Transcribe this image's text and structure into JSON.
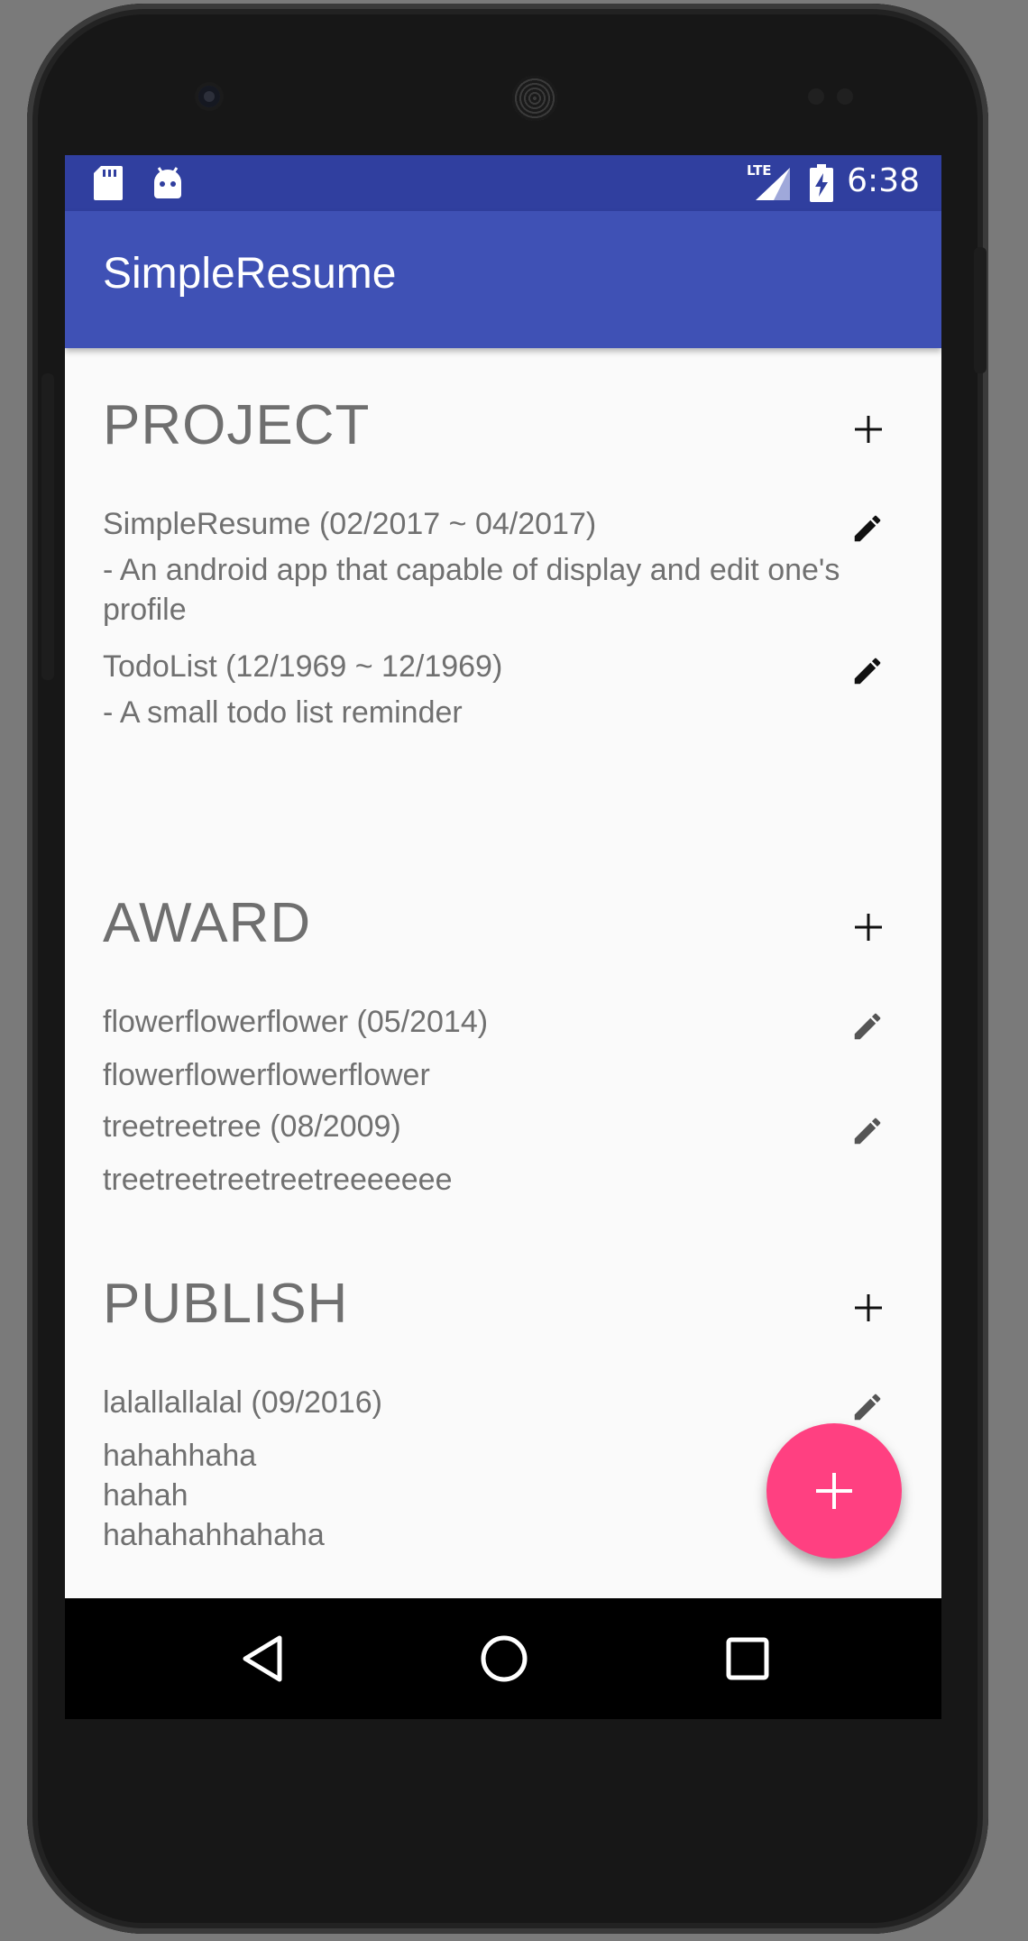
{
  "status_bar": {
    "time": "6:38",
    "network": "LTE",
    "icons": [
      "sd-card-icon",
      "android-icon",
      "signal-icon",
      "battery-charging-icon"
    ]
  },
  "app_bar": {
    "title": "SimpleResume"
  },
  "sections": {
    "project": {
      "title": "PROJECT",
      "items": [
        {
          "heading": "SimpleResume (02/2017 ~ 04/2017)",
          "description": " - An android app that capable of display and edit one's profile"
        },
        {
          "heading": "TodoList (12/1969 ~ 12/1969)",
          "description": " - A small todo list reminder"
        }
      ]
    },
    "award": {
      "title": "AWARD",
      "items": [
        {
          "heading": "flowerflowerflower (05/2014)",
          "description": "flowerflowerflowerflower"
        },
        {
          "heading": "treetreetree (08/2009)",
          "description": "treetreetreetreetreeeeeee"
        }
      ]
    },
    "publish": {
      "title": "PUBLISH",
      "items": [
        {
          "heading": "lalallallalal (09/2016)",
          "description": "hahahhaha\nhahah\nhahahahhahaha"
        }
      ]
    }
  },
  "colors": {
    "status_bar": "#303f9f",
    "app_bar": "#3f51b5",
    "fab": "#ff4081",
    "text_secondary": "#707070"
  },
  "icons": {
    "add": "plus-icon",
    "edit": "pencil-icon",
    "fab": "plus-icon",
    "nav": [
      "back-icon",
      "home-icon",
      "recents-icon"
    ]
  }
}
